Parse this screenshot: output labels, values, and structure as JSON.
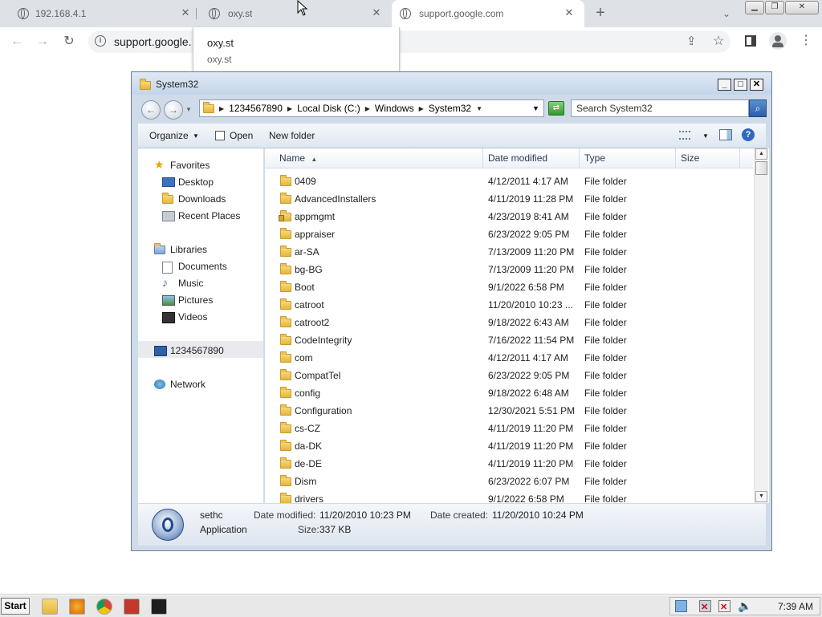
{
  "browser": {
    "tabs": [
      {
        "title": "192.168.4.1",
        "active": false
      },
      {
        "title": "oxy.st",
        "active": false
      },
      {
        "title": "support.google.com",
        "active": true
      }
    ],
    "new_tab_glyph": "+",
    "address": "support.google.",
    "suggestions": {
      "primary": "oxy.st",
      "secondary": "oxy.st"
    },
    "icons": {
      "back": "arrow-left-icon",
      "forward": "arrow-right-icon",
      "reload": "reload-icon",
      "share": "share-icon",
      "bookmark": "star-icon",
      "sidepanel": "side-panel-icon",
      "profile": "profile-icon",
      "menu": "kebab-menu-icon"
    }
  },
  "explorer": {
    "title": "System32",
    "breadcrumbs": [
      "1234567890",
      "Local Disk (C:)",
      "Windows",
      "System32"
    ],
    "search_placeholder": "Search System32",
    "commands": {
      "organize": "Organize",
      "open": "Open",
      "new_folder": "New folder"
    },
    "nav": {
      "favorites": "Favorites",
      "desktop": "Desktop",
      "downloads": "Downloads",
      "recent": "Recent Places",
      "libraries": "Libraries",
      "documents": "Documents",
      "music": "Music",
      "pictures": "Pictures",
      "videos": "Videos",
      "computer": "1234567890",
      "network": "Network"
    },
    "columns": {
      "name": "Name",
      "date": "Date modified",
      "type": "Type",
      "size": "Size"
    },
    "rows": [
      {
        "name": "0409",
        "date": "4/12/2011 4:17 AM",
        "type": "File folder"
      },
      {
        "name": "AdvancedInstallers",
        "date": "4/11/2019 11:28 PM",
        "type": "File folder"
      },
      {
        "name": "appmgmt",
        "date": "4/23/2019 8:41 AM",
        "type": "File folder"
      },
      {
        "name": "appraiser",
        "date": "6/23/2022 9:05 PM",
        "type": "File folder"
      },
      {
        "name": "ar-SA",
        "date": "7/13/2009 11:20 PM",
        "type": "File folder"
      },
      {
        "name": "bg-BG",
        "date": "7/13/2009 11:20 PM",
        "type": "File folder"
      },
      {
        "name": "Boot",
        "date": "9/1/2022 6:58 PM",
        "type": "File folder"
      },
      {
        "name": "catroot",
        "date": "11/20/2010 10:23 ...",
        "type": "File folder"
      },
      {
        "name": "catroot2",
        "date": "9/18/2022 6:43 AM",
        "type": "File folder"
      },
      {
        "name": "CodeIntegrity",
        "date": "7/16/2022 11:54 PM",
        "type": "File folder"
      },
      {
        "name": "com",
        "date": "4/12/2011 4:17 AM",
        "type": "File folder"
      },
      {
        "name": "CompatTel",
        "date": "6/23/2022 9:05 PM",
        "type": "File folder"
      },
      {
        "name": "config",
        "date": "9/18/2022 6:48 AM",
        "type": "File folder"
      },
      {
        "name": "Configuration",
        "date": "12/30/2021 5:51 PM",
        "type": "File folder"
      },
      {
        "name": "cs-CZ",
        "date": "4/11/2019 11:20 PM",
        "type": "File folder"
      },
      {
        "name": "da-DK",
        "date": "4/11/2019 11:20 PM",
        "type": "File folder"
      },
      {
        "name": "de-DE",
        "date": "4/11/2019 11:20 PM",
        "type": "File folder"
      },
      {
        "name": "Dism",
        "date": "6/23/2022 6:07 PM",
        "type": "File folder"
      },
      {
        "name": "drivers",
        "date": "9/1/2022 6:58 PM",
        "type": "File folder"
      }
    ],
    "details": {
      "name": "sethc",
      "kind": "Application",
      "modified_label": "Date modified:",
      "modified": "11/20/2010 10:23 PM",
      "created_label": "Date created:",
      "created": "11/20/2010 10:24 PM",
      "size_label": "Size:",
      "size": "337 KB"
    }
  },
  "taskbar": {
    "start": "Start",
    "clock": "7:39 AM"
  },
  "colors": {
    "tabstrip": "#dee1e6",
    "explorer_frame": "#cfdbe9",
    "accent": "#2a5ea8"
  }
}
